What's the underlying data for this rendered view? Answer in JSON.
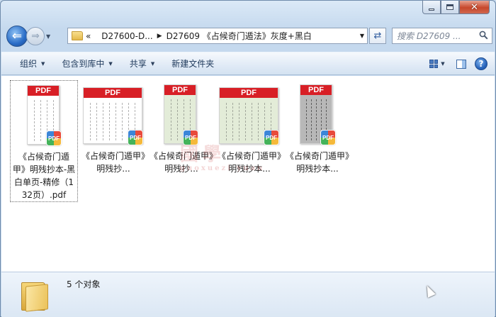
{
  "window": {
    "controls": {
      "minimize_icon": "minimize-icon",
      "maximize_icon": "maximize-icon",
      "close_glyph": "✕"
    }
  },
  "nav": {
    "back_glyph": "⇐",
    "forward_glyph": "⇒",
    "breadcrumb_overflow": "«",
    "breadcrumb": [
      "D27600-D...",
      "D27609 《占候奇门遁法》灰度+黑白"
    ],
    "search_placeholder": "搜索 D27609 ..."
  },
  "toolbar": {
    "organize": "组织",
    "include_library": "包含到库中",
    "share": "共享",
    "new_folder": "新建文件夹"
  },
  "files": [
    {
      "name": "《占候奇门遁甲》明残抄本-黑白单页-精修（132页）.pdf",
      "thumb_style": "white-wide",
      "selected": true
    },
    {
      "name": "《占候奇门遁甲》明残抄...",
      "thumb_style": "white-wide",
      "selected": false
    },
    {
      "name": "《占候奇门遁甲》明残抄...",
      "thumb_style": "green-narrow",
      "selected": false
    },
    {
      "name": "《占候奇门遁甲》明残抄本...",
      "thumb_style": "green-wide",
      "selected": false
    },
    {
      "name": "《占候奇门遁甲》明残抄本...",
      "thumb_style": "gray-narrow",
      "selected": false
    }
  ],
  "thumb_label": "PDF",
  "badge_label": "PDF",
  "watermark": {
    "main": "國學",
    "sub": "guoxuezi yuan"
  },
  "status": {
    "count_text": "5 个对象"
  },
  "colors": {
    "pdf_red": "#d81f26",
    "accent_blue": "#2a6cc6"
  }
}
